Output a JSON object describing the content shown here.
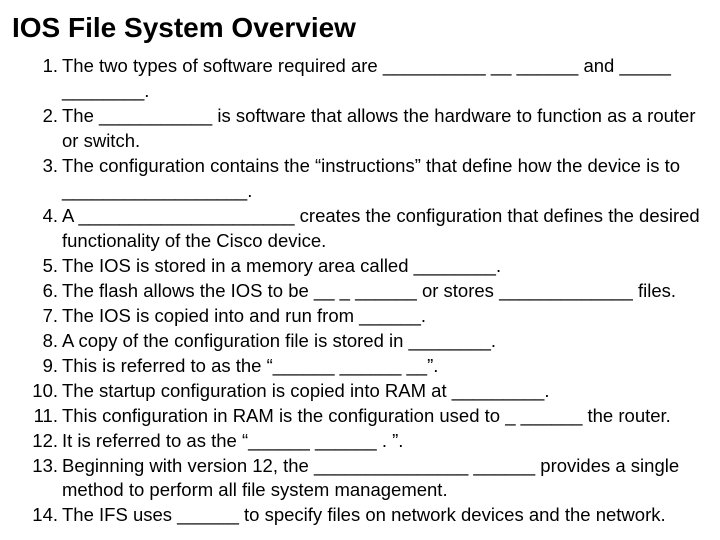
{
  "title": "IOS File System Overview",
  "items": [
    "The two types of software required are __________ __ ______ and _____ ________.",
    "The ___________ is software that allows the hardware to function as a router or switch.",
    "The configuration contains the “instructions” that define how the device is to __________________.",
    "A _____________________ creates the configuration that defines the desired functionality of the Cisco device.",
    "The IOS is stored in a memory area called ________.",
    "The flash allows the IOS to be __ _ ______ or stores _____________ files.",
    "The IOS is copied into and run from ______.",
    "A copy of the configuration file is stored in ________.",
    "This is referred to as the “______ ______ __”.",
    "The startup configuration is copied into RAM at _________.",
    "This configuration in RAM is the configuration used to _ ______ the router.",
    "It is referred to as the “______ ______ . ”.",
    "Beginning with version 12, the _______________ ______ provides a single method to perform all file system management.",
    "The IFS uses ______ to specify files on network devices and the network."
  ]
}
